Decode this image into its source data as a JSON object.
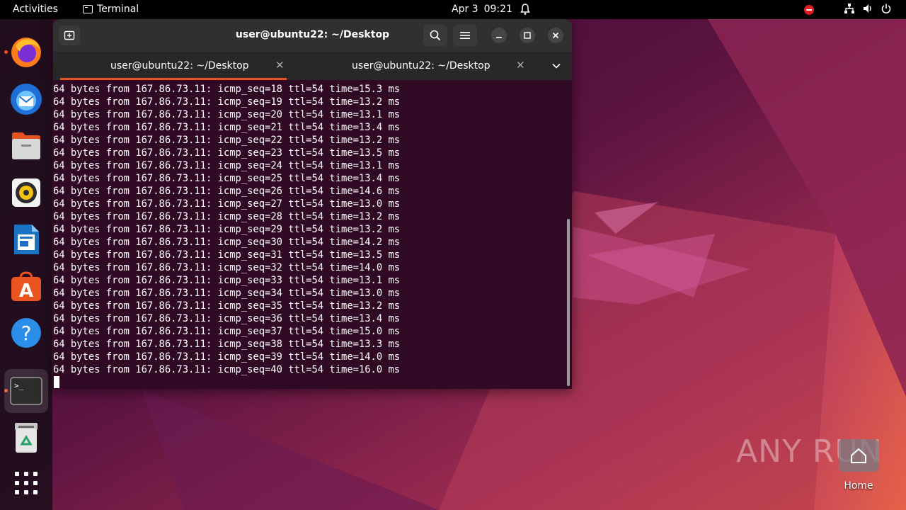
{
  "topbar": {
    "activities": "Activities",
    "app_name": "Terminal",
    "date": "Apr 3",
    "time": "09:21"
  },
  "dock": {
    "items": [
      {
        "name": "firefox",
        "icon": "firefox-icon"
      },
      {
        "name": "thunderbird",
        "icon": "thunderbird-icon"
      },
      {
        "name": "files",
        "icon": "files-icon"
      },
      {
        "name": "rhythmbox",
        "icon": "rhythmbox-icon"
      },
      {
        "name": "libreoffice-writer",
        "icon": "writer-icon"
      },
      {
        "name": "app-center",
        "icon": "app-store-icon"
      },
      {
        "name": "help",
        "icon": "help-icon"
      },
      {
        "name": "terminal",
        "icon": "terminal-icon"
      },
      {
        "name": "trash",
        "icon": "trash-icon"
      },
      {
        "name": "show-apps",
        "icon": "app-grid-icon"
      }
    ]
  },
  "window": {
    "title": "user@ubuntu22: ~/Desktop",
    "tabs": [
      {
        "label": "user@ubuntu22: ~/Desktop",
        "active": true
      },
      {
        "label": "user@ubuntu22: ~/Desktop",
        "active": false
      }
    ],
    "lines": [
      "64 bytes from 167.86.73.11: icmp_seq=18 ttl=54 time=15.3 ms",
      "64 bytes from 167.86.73.11: icmp_seq=19 ttl=54 time=13.2 ms",
      "64 bytes from 167.86.73.11: icmp_seq=20 ttl=54 time=13.1 ms",
      "64 bytes from 167.86.73.11: icmp_seq=21 ttl=54 time=13.4 ms",
      "64 bytes from 167.86.73.11: icmp_seq=22 ttl=54 time=13.2 ms",
      "64 bytes from 167.86.73.11: icmp_seq=23 ttl=54 time=13.5 ms",
      "64 bytes from 167.86.73.11: icmp_seq=24 ttl=54 time=13.1 ms",
      "64 bytes from 167.86.73.11: icmp_seq=25 ttl=54 time=13.4 ms",
      "64 bytes from 167.86.73.11: icmp_seq=26 ttl=54 time=14.6 ms",
      "64 bytes from 167.86.73.11: icmp_seq=27 ttl=54 time=13.0 ms",
      "64 bytes from 167.86.73.11: icmp_seq=28 ttl=54 time=13.2 ms",
      "64 bytes from 167.86.73.11: icmp_seq=29 ttl=54 time=13.2 ms",
      "64 bytes from 167.86.73.11: icmp_seq=30 ttl=54 time=14.2 ms",
      "64 bytes from 167.86.73.11: icmp_seq=31 ttl=54 time=13.5 ms",
      "64 bytes from 167.86.73.11: icmp_seq=32 ttl=54 time=14.0 ms",
      "64 bytes from 167.86.73.11: icmp_seq=33 ttl=54 time=13.1 ms",
      "64 bytes from 167.86.73.11: icmp_seq=34 ttl=54 time=13.0 ms",
      "64 bytes from 167.86.73.11: icmp_seq=35 ttl=54 time=13.2 ms",
      "64 bytes from 167.86.73.11: icmp_seq=36 ttl=54 time=13.4 ms",
      "64 bytes from 167.86.73.11: icmp_seq=37 ttl=54 time=15.0 ms",
      "64 bytes from 167.86.73.11: icmp_seq=38 ttl=54 time=13.3 ms",
      "64 bytes from 167.86.73.11: icmp_seq=39 ttl=54 time=14.0 ms",
      "64 bytes from 167.86.73.11: icmp_seq=40 ttl=54 time=16.0 ms"
    ]
  },
  "desktop": {
    "home_label": "Home",
    "watermark": "ANY RUN"
  },
  "colors": {
    "accent": "#e95420",
    "terminal_bg": "#300a24",
    "header_bg": "#303030"
  }
}
